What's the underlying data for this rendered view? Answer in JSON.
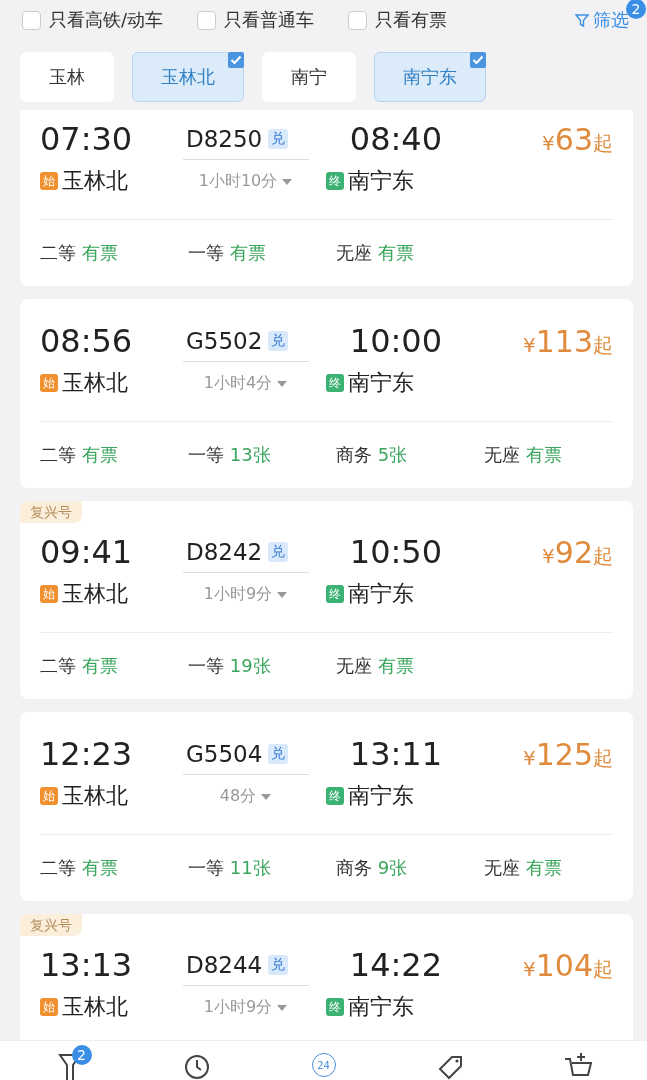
{
  "filters": [
    {
      "label": "只看高铁/动车",
      "checked": false
    },
    {
      "label": "只看普通车",
      "checked": false
    },
    {
      "label": "只看有票",
      "checked": false
    }
  ],
  "filter_button": {
    "label": "筛选",
    "badge": "2"
  },
  "stations": [
    {
      "name": "玉林",
      "selected": false
    },
    {
      "name": "玉林北",
      "selected": true
    },
    {
      "name": "南宁",
      "selected": false
    },
    {
      "name": "南宁东",
      "selected": true
    }
  ],
  "trains": [
    {
      "depart_time": "07:30",
      "train_number": "D8250",
      "exchange": "兑",
      "arrive_time": "08:40",
      "price_symbol": "¥",
      "price": "63",
      "price_suffix": "起",
      "from_tag": "始",
      "from": "玉林北",
      "duration": "1小时10分",
      "to_tag": "终",
      "to": "南宁东",
      "seats": [
        {
          "class": "二等",
          "availability": "有票"
        },
        {
          "class": "一等",
          "availability": "有票"
        },
        {
          "class": "无座",
          "availability": "有票"
        }
      ]
    },
    {
      "depart_time": "08:56",
      "train_number": "G5502",
      "exchange": "兑",
      "arrive_time": "10:00",
      "price_symbol": "¥",
      "price": "113",
      "price_suffix": "起",
      "from_tag": "始",
      "from": "玉林北",
      "duration": "1小时4分",
      "to_tag": "终",
      "to": "南宁东",
      "seats": [
        {
          "class": "二等",
          "availability": "有票"
        },
        {
          "class": "一等",
          "availability": "13张"
        },
        {
          "class": "商务",
          "availability": "5张"
        },
        {
          "class": "无座",
          "availability": "有票"
        }
      ]
    },
    {
      "badge": "复兴号",
      "depart_time": "09:41",
      "train_number": "D8242",
      "exchange": "兑",
      "arrive_time": "10:50",
      "price_symbol": "¥",
      "price": "92",
      "price_suffix": "起",
      "from_tag": "始",
      "from": "玉林北",
      "duration": "1小时9分",
      "to_tag": "终",
      "to": "南宁东",
      "seats": [
        {
          "class": "二等",
          "availability": "有票"
        },
        {
          "class": "一等",
          "availability": "19张"
        },
        {
          "class": "无座",
          "availability": "有票"
        }
      ]
    },
    {
      "depart_time": "12:23",
      "train_number": "G5504",
      "exchange": "兑",
      "arrive_time": "13:11",
      "price_symbol": "¥",
      "price": "125",
      "price_suffix": "起",
      "from_tag": "始",
      "from": "玉林北",
      "duration": "48分",
      "to_tag": "终",
      "to": "南宁东",
      "seats": [
        {
          "class": "二等",
          "availability": "有票"
        },
        {
          "class": "一等",
          "availability": "11张"
        },
        {
          "class": "商务",
          "availability": "9张"
        },
        {
          "class": "无座",
          "availability": "有票"
        }
      ]
    },
    {
      "badge": "复兴号",
      "depart_time": "13:13",
      "train_number": "D8244",
      "exchange": "兑",
      "arrive_time": "14:22",
      "price_symbol": "¥",
      "price": "104",
      "price_suffix": "起",
      "from_tag": "始",
      "from": "玉林北",
      "duration": "1小时9分",
      "to_tag": "终",
      "to": "南宁东"
    }
  ],
  "bottom_nav": [
    {
      "kind": "filter",
      "badge": "2"
    },
    {
      "kind": "clock"
    },
    {
      "kind": "day",
      "label": "24"
    },
    {
      "kind": "tag"
    },
    {
      "kind": "cart"
    }
  ]
}
